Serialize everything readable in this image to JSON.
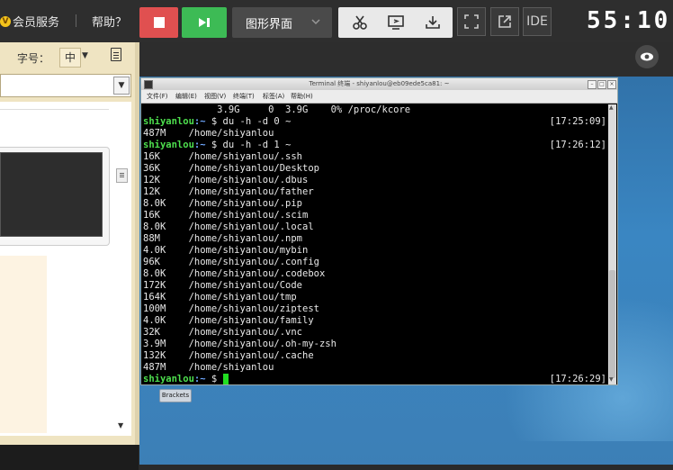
{
  "topbar": {
    "vip_label": "会员服务",
    "help_label": "帮助？",
    "mode_label": "图形界面",
    "ide_label": "IDE",
    "timer": "55:10"
  },
  "left_panel": {
    "fontsize_label": "字号：",
    "fontsize_value": "中"
  },
  "terminal": {
    "title": "Terminal 终端 - shiyanlou@eb09ede5ca81: ~",
    "menu": [
      "文件(F)",
      "编辑(E)",
      "视图(V)",
      "终端(T)",
      "标签(A)",
      "帮助(H)"
    ],
    "lines": [
      {
        "text": "             3.9G     0  3.9G    0% /proc/kcore"
      },
      {
        "prompt": "shiyanlou",
        "path": ":~",
        "cmd": " $ du -h -d 0 ~",
        "time": "[17:25:09]"
      },
      {
        "text": "487M    /home/shiyanlou"
      },
      {
        "prompt": "shiyanlou",
        "path": ":~",
        "cmd": " $ du -h -d 1 ~",
        "time": "[17:26:12]"
      },
      {
        "text": "16K     /home/shiyanlou/.ssh"
      },
      {
        "text": "36K     /home/shiyanlou/Desktop"
      },
      {
        "text": "12K     /home/shiyanlou/.dbus"
      },
      {
        "text": "12K     /home/shiyanlou/father"
      },
      {
        "text": "8.0K    /home/shiyanlou/.pip"
      },
      {
        "text": "16K     /home/shiyanlou/.scim"
      },
      {
        "text": "8.0K    /home/shiyanlou/.local"
      },
      {
        "text": "88M     /home/shiyanlou/.npm"
      },
      {
        "text": "4.0K    /home/shiyanlou/mybin"
      },
      {
        "text": "96K     /home/shiyanlou/.config"
      },
      {
        "text": "8.0K    /home/shiyanlou/.codebox"
      },
      {
        "text": "172K    /home/shiyanlou/Code"
      },
      {
        "text": "164K    /home/shiyanlou/tmp"
      },
      {
        "text": "100M    /home/shiyanlou/ziptest"
      },
      {
        "text": "4.0K    /home/shiyanlou/family"
      },
      {
        "text": "32K     /home/shiyanlou/.vnc"
      },
      {
        "text": "3.9M    /home/shiyanlou/.oh-my-zsh"
      },
      {
        "text": "132K    /home/shiyanlou/.cache"
      },
      {
        "text": "487M    /home/shiyanlou"
      },
      {
        "prompt": "shiyanlou",
        "path": ":~",
        "cmd": " $ ",
        "time": "[17:26:29]",
        "cursor": true
      }
    ]
  },
  "desktop": {
    "brackets_label": "Brackets"
  },
  "colors": {
    "stop": "#e05050",
    "run": "#3dbb55",
    "prompt": "#4ee04e",
    "desktop": "#3a86c2"
  },
  "icons": [
    "crown-icon",
    "stop-icon",
    "step-icon",
    "chevron-down-icon",
    "scissors-icon",
    "screen-share-icon",
    "download-icon",
    "fullscreen-icon",
    "external-link-icon",
    "eye-icon",
    "document-icon"
  ]
}
